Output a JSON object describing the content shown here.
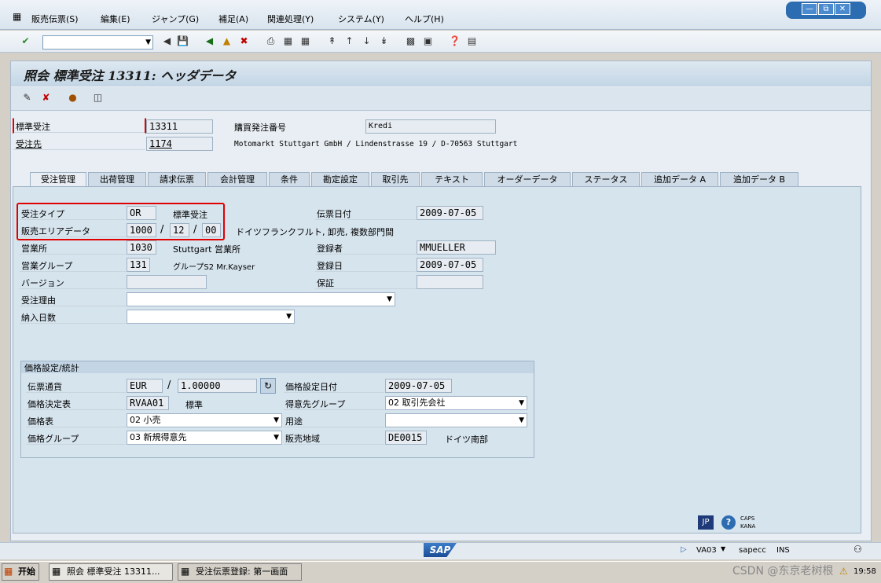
{
  "menu": [
    "販売伝票(S)",
    "編集(E)",
    "ジャンプ(G)",
    "補足(A)",
    "関連処理(Y)",
    "システム(Y)",
    "ヘルプ(H)"
  ],
  "title": "照会 標準受注 13311: ヘッダデータ",
  "header": {
    "order_type_label": "標準受注",
    "order_number": "13311",
    "po_label": "購買発注番号",
    "po_value": "Kredi",
    "soldto_label": "受注先",
    "soldto_value": "1174",
    "soldto_address": "Motomarkt Stuttgart GmbH / Lindenstrasse 19 / D-70563 Stuttgart"
  },
  "tabs": [
    "受注管理",
    "出荷管理",
    "請求伝票",
    "会計管理",
    "条件",
    "勘定設定",
    "取引先",
    "テキスト",
    "オーダーデータ",
    "ステータス",
    "追加データ A",
    "追加データ B"
  ],
  "form": {
    "order_type_label": "受注タイプ",
    "order_type": "OR",
    "order_type_desc": "標準受注",
    "doc_date_label": "伝票日付",
    "doc_date": "2009-07-05",
    "sales_area_label": "販売エリアデータ",
    "sales_org": "1000",
    "dist_ch": "12",
    "division": "00",
    "slash1": "/",
    "slash2": "/",
    "sales_area_desc": "ドイツフランクフルト, 卸売, 複数部門間",
    "sales_office_label": "営業所",
    "sales_office": "1030",
    "sales_office_desc": "Stuttgart 営業所",
    "created_by_label": "登録者",
    "created_by": "MMUELLER",
    "sales_group_label": "営業グループ",
    "sales_group": "131",
    "sales_group_desc": "グループS2 Mr.Kayser",
    "created_on_label": "登録日",
    "created_on": "2009-07-05",
    "version_label": "バージョン",
    "warranty_label": "保証",
    "reason_label": "受注理由",
    "delivery_days_label": "納入日数"
  },
  "pricing": {
    "header": "価格設定/統計",
    "currency_label": "伝票通貨",
    "currency": "EUR",
    "rate_slash": "/",
    "rate": "1.00000",
    "pricing_date_label": "価格設定日付",
    "pricing_date": "2009-07-05",
    "procedure_label": "価格決定表",
    "procedure": "RVAA01",
    "procedure_desc": "標準",
    "cust_group_label": "得意先グループ",
    "cust_group": "02 取引先会社",
    "price_list_label": "価格表",
    "price_list": "02 小売",
    "usage_label": "用途",
    "price_group_label": "価格グループ",
    "price_group": "03 新規得意先",
    "region_label": "販売地域",
    "region": "DE0015",
    "region_desc": "ドイツ南部"
  },
  "status": {
    "tcode": "VA03",
    "system": "sapecc",
    "mode": "INS",
    "logo": "SAP",
    "lang": "JP",
    "caps": "CAPS",
    "kana": "KANA"
  },
  "taskbar": {
    "start": "开始",
    "task1": "照会 標準受注 13311...",
    "task2": "受注伝票登録: 第一画面",
    "clock": "19:58",
    "watermark": "CSDN @东京老树根"
  },
  "colors": {
    "highlight": "#e00000",
    "accent": "#2c6cb0"
  }
}
